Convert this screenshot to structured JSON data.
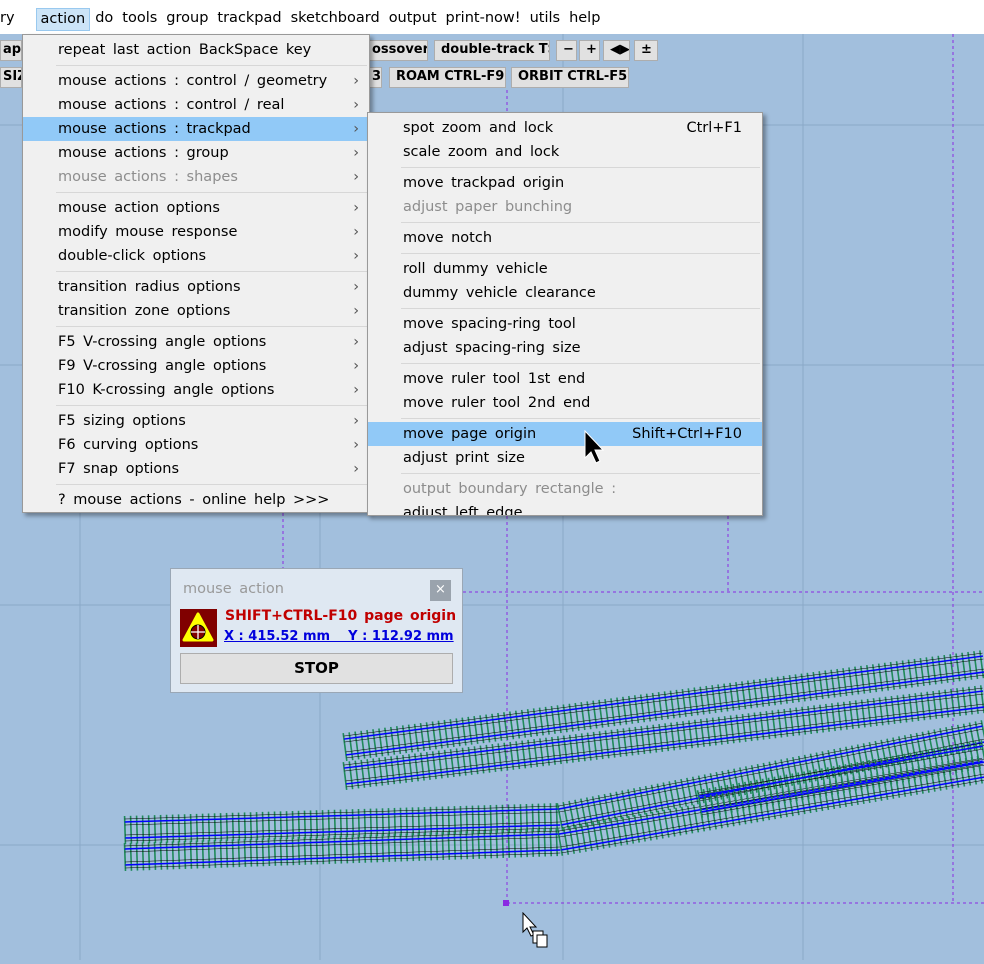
{
  "menubar": {
    "items": [
      "ry",
      "action",
      "do",
      "tools",
      "group",
      "trackpad",
      "sketchboard",
      "output",
      "print-now!",
      "utils",
      "help"
    ],
    "active": "action"
  },
  "toolbar": {
    "row1": [
      "app",
      "ossover",
      "double-track TS",
      "−",
      "+",
      "◀▶",
      "±"
    ],
    "row2": [
      "SIZ",
      "3",
      "ROAM  CTRL-F9",
      "ORBIT  CTRL-F5"
    ]
  },
  "action_menu": {
    "items": [
      {
        "label": "repeat  last  action    BackSpace  key"
      },
      {
        "sep": true
      },
      {
        "label": "mouse  actions :  control / geometry",
        "sub": true
      },
      {
        "label": "mouse  actions :  control / real",
        "sub": true
      },
      {
        "label": "mouse  actions :  trackpad",
        "sub": true,
        "highlighted": true
      },
      {
        "label": "mouse  actions :  group",
        "sub": true
      },
      {
        "label": "mouse  actions :  shapes",
        "sub": true,
        "disabled": true
      },
      {
        "sep": true
      },
      {
        "label": "mouse  action  options",
        "sub": true
      },
      {
        "label": "modify  mouse  response",
        "sub": true
      },
      {
        "label": "double-click  options",
        "sub": true
      },
      {
        "sep": true
      },
      {
        "label": "transition  radius  options",
        "sub": true
      },
      {
        "label": "transition  zone  options",
        "sub": true
      },
      {
        "sep": true
      },
      {
        "label": "F5  V-crossing  angle  options",
        "sub": true
      },
      {
        "label": "F9  V-crossing  angle  options",
        "sub": true
      },
      {
        "label": "F10  K-crossing  angle  options",
        "sub": true
      },
      {
        "sep": true
      },
      {
        "label": "F5  sizing  options",
        "sub": true
      },
      {
        "label": "F6  curving  options",
        "sub": true
      },
      {
        "label": "F7  snap  options",
        "sub": true
      },
      {
        "sep": true
      },
      {
        "label": "? mouse  actions  -  online  help  >>>"
      }
    ]
  },
  "trackpad_submenu": {
    "items": [
      {
        "label": "spot  zoom  and  lock",
        "shortcut": "Ctrl+F1"
      },
      {
        "label": "scale  zoom  and  lock"
      },
      {
        "sep": true
      },
      {
        "label": "move  trackpad  origin"
      },
      {
        "label": "adjust  paper  bunching",
        "disabled": true
      },
      {
        "sep": true
      },
      {
        "label": "move  notch"
      },
      {
        "sep": true
      },
      {
        "label": "roll  dummy  vehicle"
      },
      {
        "label": "dummy  vehicle  clearance"
      },
      {
        "sep": true
      },
      {
        "label": "move  spacing-ring  tool"
      },
      {
        "label": "adjust  spacing-ring  size"
      },
      {
        "sep": true
      },
      {
        "label": "move  ruler  tool  1st  end"
      },
      {
        "label": "move  ruler  tool  2nd  end"
      },
      {
        "sep": true
      },
      {
        "label": "move  page  origin",
        "shortcut": "Shift+Ctrl+F10",
        "highlighted": true
      },
      {
        "label": "adjust  print  size"
      },
      {
        "sep": true
      },
      {
        "label": "output  boundary  rectangle :",
        "disabled": true
      },
      {
        "label": "adjust  left  edge"
      }
    ]
  },
  "dialog": {
    "title": "mouse  action",
    "close": "×",
    "mode": "SHIFT+CTRL-F10  page  origin",
    "coords": "X : 415.52 mm    Y : 112.92 mm",
    "stop": "STOP"
  },
  "colors": {
    "canvas": "#a2bfdd",
    "highlight": "#91c9f7",
    "guide": "#8a2be2",
    "rail": "#0000ff",
    "sleeper": "#1f8a5a",
    "dialog_mode": "#c00000",
    "dialog_coords": "#0000dd"
  }
}
